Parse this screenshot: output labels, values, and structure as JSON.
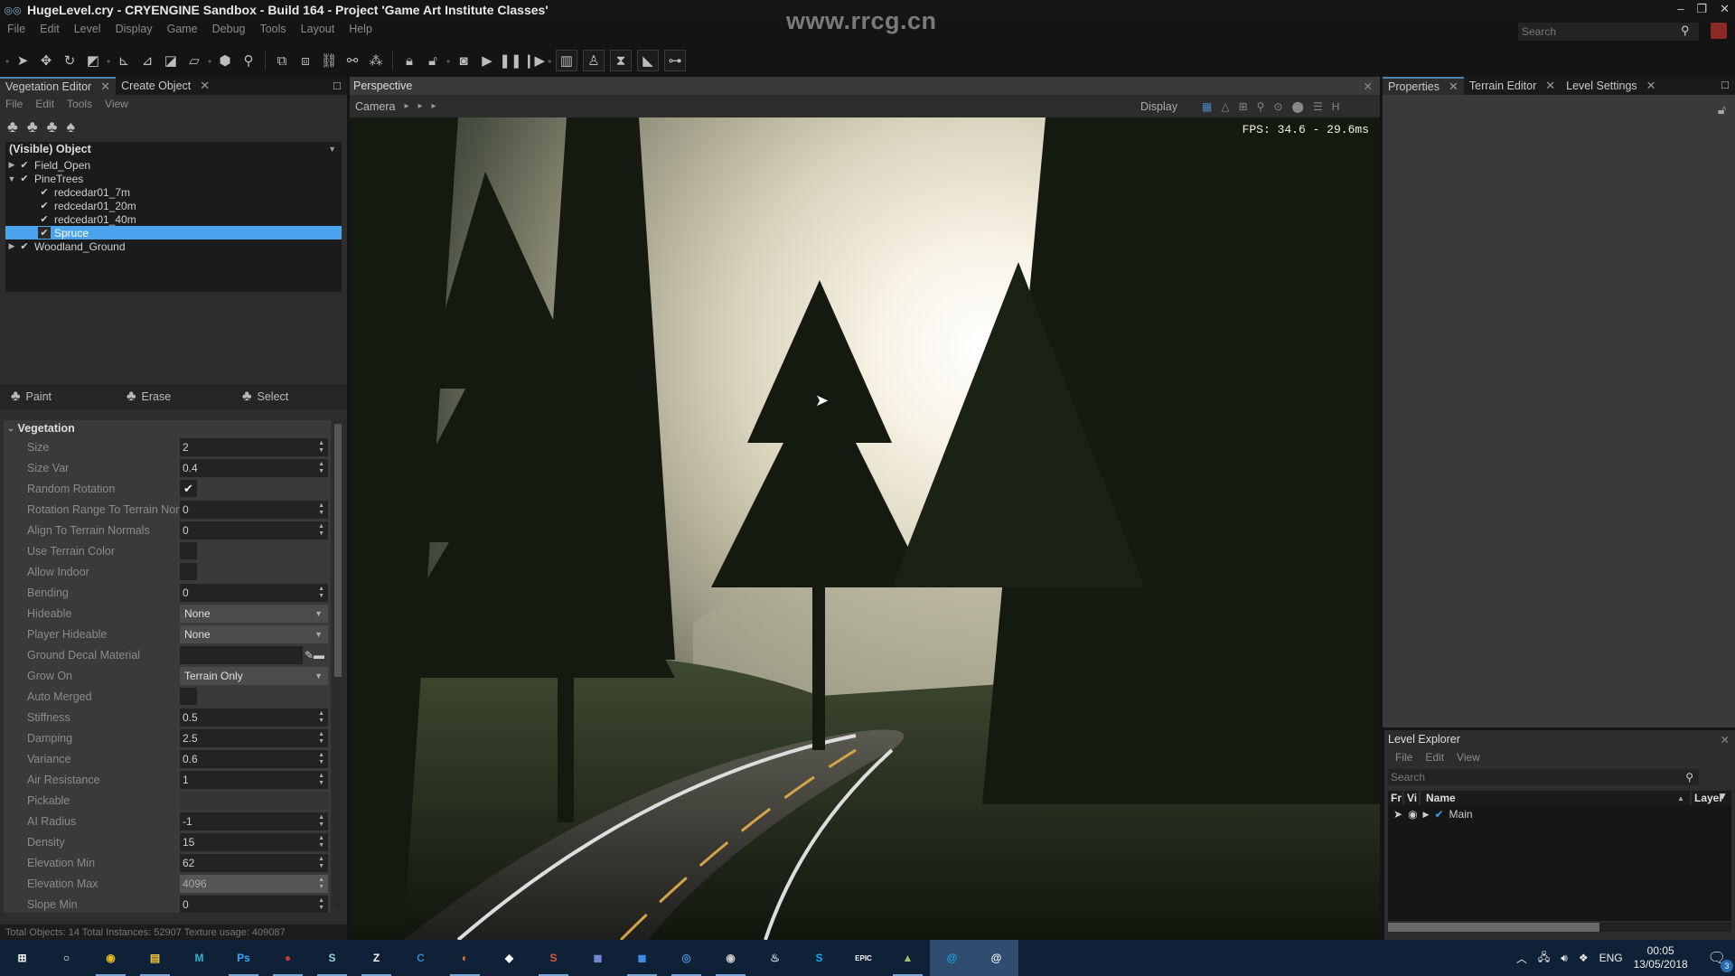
{
  "window": {
    "title": "HugeLevel.cry - CRYENGINE Sandbox - Build 164 - Project 'Game Art Institute Classes'",
    "watermark": "www.rrcg.cn",
    "controls": {
      "minimize": "–",
      "restore": "❐",
      "close": "✕"
    }
  },
  "menu": [
    "File",
    "Edit",
    "Level",
    "Display",
    "Game",
    "Debug",
    "Tools",
    "Layout",
    "Help"
  ],
  "global_search": {
    "placeholder": "Search"
  },
  "toolbar": {
    "icons": [
      "select-icon",
      "move-icon",
      "rotate-icon",
      "scale-icon",
      "axis-constraint-icon",
      "snap-to-grid-icon",
      "snap-to-angle-icon",
      "snap-to-terrain-icon",
      "select-object-icon",
      "zoom-to-object-icon",
      "group-icon",
      "ungroup-icon",
      "link-icon",
      "unlink-icon",
      "attach-icon",
      "lock-icon",
      "unlock-icon",
      "game-mode-icon",
      "play-icon",
      "pause-icon",
      "step-icon",
      "layout-icon",
      "ai-person-icon",
      "director-icon",
      "terrain-icon",
      "flowgraph-icon"
    ]
  },
  "left_panel": {
    "tabs": [
      {
        "label": "Vegetation Editor",
        "active": true
      },
      {
        "label": "Create Object",
        "active": false
      }
    ],
    "menu": [
      "File",
      "Edit",
      "Tools",
      "View"
    ],
    "tree_header": "(Visible) Object",
    "tree": [
      {
        "label": "Field_Open",
        "level": 0,
        "expanded": false,
        "checked": true,
        "selected": false
      },
      {
        "label": "PineTrees",
        "level": 0,
        "expanded": true,
        "checked": true,
        "selected": false
      },
      {
        "label": "redcedar01_7m",
        "level": 1,
        "checked": true,
        "selected": false
      },
      {
        "label": "redcedar01_20m",
        "level": 1,
        "checked": true,
        "selected": false
      },
      {
        "label": "redcedar01_40m",
        "level": 1,
        "checked": true,
        "selected": false
      },
      {
        "label": "Spruce",
        "level": 1,
        "checked": true,
        "selected": true
      },
      {
        "label": "Woodland_Ground",
        "level": 0,
        "expanded": false,
        "checked": true,
        "selected": false
      }
    ],
    "modes": [
      "Paint",
      "Erase",
      "Select"
    ],
    "section": "Vegetation",
    "properties": [
      {
        "label": "Size",
        "type": "number",
        "value": "2"
      },
      {
        "label": "Size Var",
        "type": "number",
        "value": "0.4"
      },
      {
        "label": "Random Rotation",
        "type": "check",
        "value": true
      },
      {
        "label": "Rotation Range To Terrain Normals",
        "type": "number",
        "value": "0"
      },
      {
        "label": "Align To Terrain Normals",
        "type": "number",
        "value": "0"
      },
      {
        "label": "Use Terrain Color",
        "type": "check",
        "value": false
      },
      {
        "label": "Allow Indoor",
        "type": "check",
        "value": false
      },
      {
        "label": "Bending",
        "type": "number",
        "value": "0"
      },
      {
        "label": "Hideable",
        "type": "combo",
        "value": "None"
      },
      {
        "label": "Player Hideable",
        "type": "combo",
        "value": "None"
      },
      {
        "label": "Ground Decal Material",
        "type": "material",
        "value": ""
      },
      {
        "label": "Grow On",
        "type": "combo",
        "value": "Terrain Only"
      },
      {
        "label": "Auto Merged",
        "type": "check",
        "value": false
      },
      {
        "label": "Stiffness",
        "type": "number",
        "value": "0.5"
      },
      {
        "label": "Damping",
        "type": "number",
        "value": "2.5"
      },
      {
        "label": "Variance",
        "type": "number",
        "value": "0.6"
      },
      {
        "label": "Air Resistance",
        "type": "number",
        "value": "1"
      },
      {
        "label": "Pickable",
        "type": "empty",
        "value": ""
      },
      {
        "label": "AI Radius",
        "type": "number",
        "value": "-1"
      },
      {
        "label": "Density",
        "type": "number",
        "value": "15"
      },
      {
        "label": "Elevation Min",
        "type": "number",
        "value": "62"
      },
      {
        "label": "Elevation Max",
        "type": "number",
        "value": "4096",
        "highlight": true
      },
      {
        "label": "Slope Min",
        "type": "number",
        "value": "0"
      }
    ],
    "status": "Total Objects: 14  Total Instances: 52907  Texture usage: 409087"
  },
  "viewport": {
    "title": "Perspective",
    "camera_label": "Camera",
    "display_label": "Display",
    "fps": "FPS: 34.6 - 29.6ms"
  },
  "right_panel": {
    "tabs": [
      {
        "label": "Properties",
        "active": true
      },
      {
        "label": "Terrain Editor",
        "active": false
      },
      {
        "label": "Level Settings",
        "active": false
      }
    ]
  },
  "level_explorer": {
    "title": "Level Explorer",
    "menu": [
      "File",
      "Edit",
      "View"
    ],
    "search_placeholder": "Search",
    "columns": [
      "Fr",
      "Vi",
      "Name",
      "Layer"
    ],
    "rows": [
      {
        "name": "Main",
        "checked": true
      }
    ]
  },
  "taskbar": {
    "apps": [
      {
        "name": "start",
        "glyph": "⊞",
        "color": "#ffffff"
      },
      {
        "name": "cortana",
        "glyph": "○",
        "color": "#ffffff"
      },
      {
        "name": "chrome",
        "glyph": "◉",
        "color": "#e8b923",
        "open": true
      },
      {
        "name": "file-explorer",
        "glyph": "▤",
        "color": "#f4c542",
        "open": true
      },
      {
        "name": "maya",
        "glyph": "M",
        "color": "#32b5c5"
      },
      {
        "name": "photoshop",
        "glyph": "Ps",
        "color": "#31a8ff",
        "open": true
      },
      {
        "name": "app-red",
        "glyph": "●",
        "color": "#c0392b",
        "open": true
      },
      {
        "name": "substance",
        "glyph": "S",
        "color": "#8fd3e0",
        "open": true
      },
      {
        "name": "zbrush",
        "glyph": "Z",
        "color": "#ffffff",
        "open": true
      },
      {
        "name": "app-blue",
        "glyph": "C",
        "color": "#2f86d6"
      },
      {
        "name": "blender",
        "glyph": "◐",
        "color": "#f5792a",
        "open": true
      },
      {
        "name": "unity",
        "glyph": "◆",
        "color": "#ffffff"
      },
      {
        "name": "app-s",
        "glyph": "S",
        "color": "#e05a3a",
        "open": true
      },
      {
        "name": "discord",
        "glyph": "◼",
        "color": "#7289da"
      },
      {
        "name": "app-cube",
        "glyph": "◼",
        "color": "#3b8de0",
        "open": true
      },
      {
        "name": "app-eye",
        "glyph": "◎",
        "color": "#4a90d9",
        "open": true
      },
      {
        "name": "obs",
        "glyph": "◉",
        "color": "#cccccc",
        "open": true
      },
      {
        "name": "steam",
        "glyph": "♨",
        "color": "#c7d5e0"
      },
      {
        "name": "skype",
        "glyph": "S",
        "color": "#00aff0"
      },
      {
        "name": "epic",
        "glyph": "EPIC",
        "color": "#ffffff"
      },
      {
        "name": "app-green",
        "glyph": "▲",
        "color": "#9bc46b",
        "open": true
      },
      {
        "name": "cryengine-launcher",
        "glyph": "@",
        "color": "#19a7e8",
        "active": true
      },
      {
        "name": "cryengine-sandbox",
        "glyph": "@",
        "color": "#ffffff",
        "active": true
      }
    ],
    "tray": {
      "lang": "ENG",
      "time": "00:05",
      "date": "13/05/2018",
      "notifications": "3"
    }
  }
}
